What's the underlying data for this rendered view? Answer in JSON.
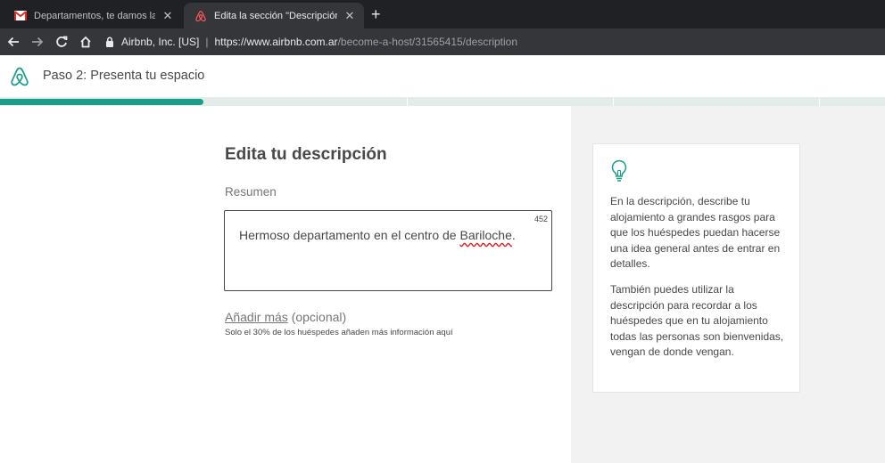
{
  "browser": {
    "tabs": [
      {
        "title": "Departamentos, te damos la bienvenida",
        "favicon": "gmail-icon",
        "active": false
      },
      {
        "title": "Edita la sección \"Descripción\" de tu anuncio",
        "favicon": "airbnb-icon",
        "active": true
      }
    ],
    "site_identity": "Airbnb, Inc. [US]",
    "url_host": "https://www.airbnb.com.ar",
    "url_path": "/become-a-host/31565415/description"
  },
  "header": {
    "step_title": "Paso 2: Presenta tu espacio",
    "progress_fraction": 0.23,
    "accent_color": "#1a9e8b"
  },
  "form": {
    "title": "Edita tu descripción",
    "summary_label": "Resumen",
    "summary_counter": "452",
    "summary_text_before": "Hermoso departamento en el centro de ",
    "summary_text_misspelled": "Bariloche",
    "summary_text_after": ".",
    "add_more_link": "Añadir más",
    "add_more_suffix": " (opcional)",
    "add_more_hint": "Solo el 30% de los huéspedes añaden más información aquí"
  },
  "tips": {
    "icon": "lightbulb-icon",
    "paragraph_1": "En la descripción, describe tu alojamiento a grandes rasgos para que los huéspedes puedan hacerse una idea general antes de entrar en detalles.",
    "paragraph_2": "También puedes utilizar la descripción para recordar a los huéspedes que en tu alojamiento todas las personas son bienvenidas, vengan de donde vengan."
  }
}
